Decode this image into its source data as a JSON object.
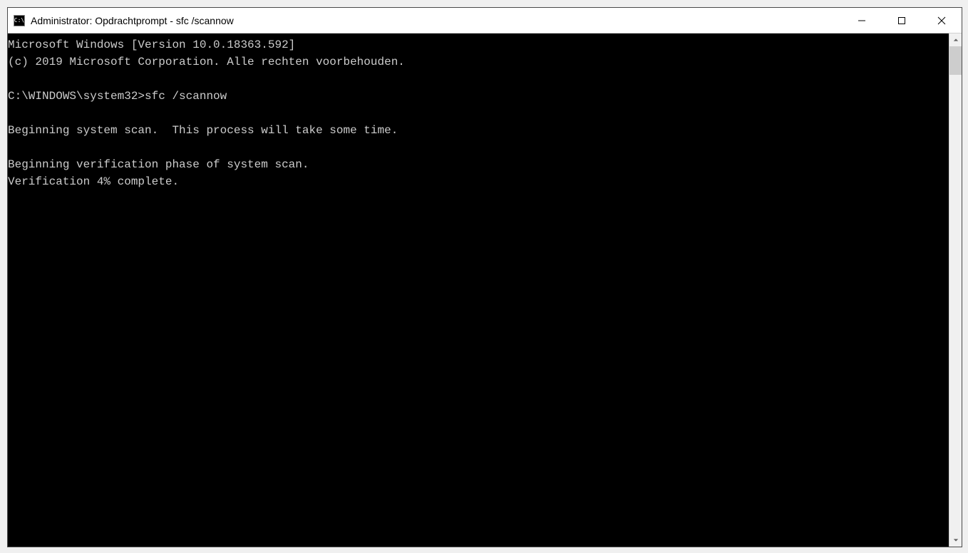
{
  "titlebar": {
    "title": "Administrator: Opdrachtprompt - sfc  /scannow"
  },
  "console": {
    "lines": [
      "Microsoft Windows [Version 10.0.18363.592]",
      "(c) 2019 Microsoft Corporation. Alle rechten voorbehouden.",
      "",
      "C:\\WINDOWS\\system32>sfc /scannow",
      "",
      "Beginning system scan.  This process will take some time.",
      "",
      "Beginning verification phase of system scan.",
      "Verification 4% complete."
    ]
  }
}
